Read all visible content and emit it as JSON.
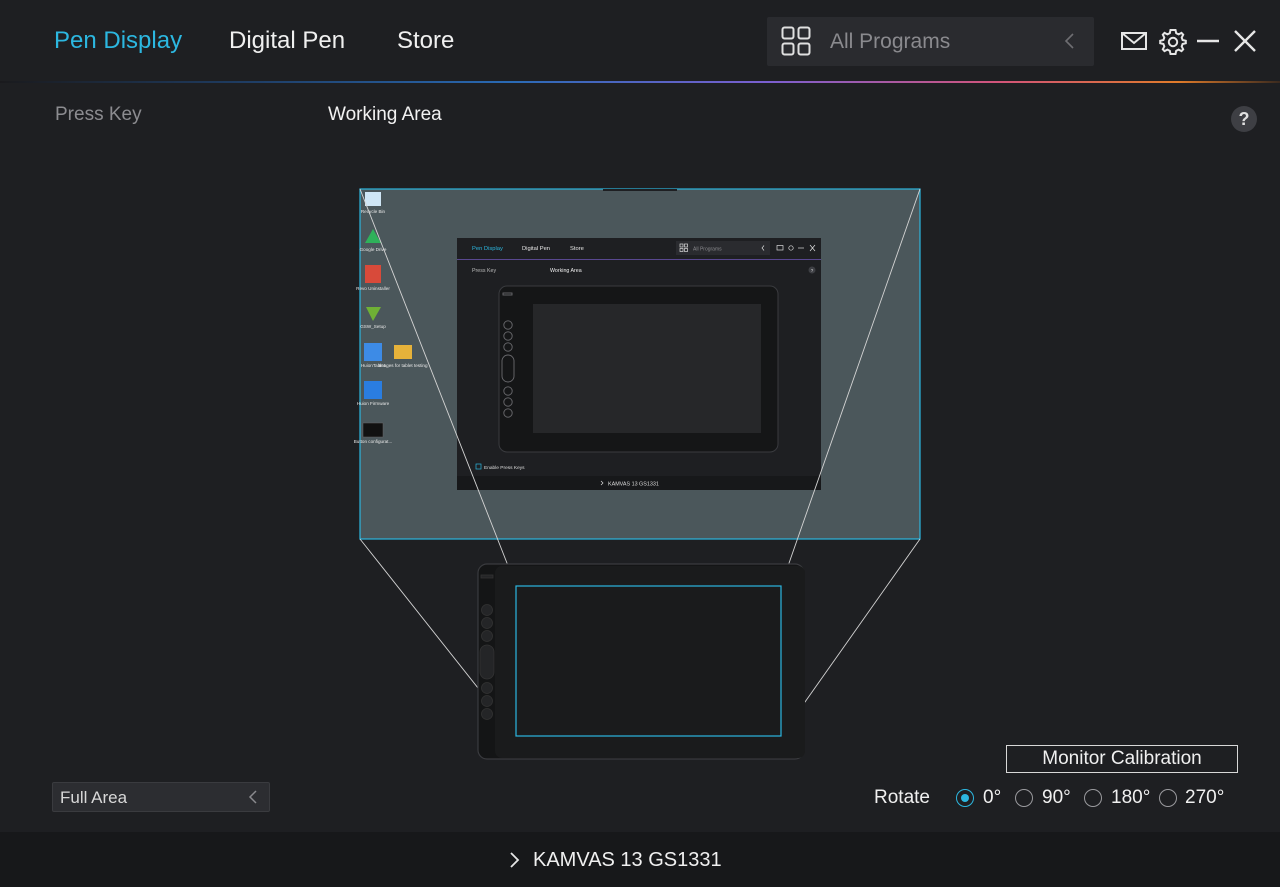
{
  "header": {
    "tabs": [
      {
        "label": "Pen Display",
        "active": true
      },
      {
        "label": "Digital Pen",
        "active": false
      },
      {
        "label": "Store",
        "active": false
      }
    ],
    "program_selector": {
      "label": "All Programs"
    },
    "icons": [
      "mail-icon",
      "gear-icon",
      "minimize-icon",
      "close-icon"
    ]
  },
  "subtabs": [
    {
      "label": "Press Key",
      "active": false
    },
    {
      "label": "Working Area",
      "active": true
    }
  ],
  "help_label": "?",
  "preview": {
    "desktop_icons": [
      "Recycle Bin",
      "Google Drive",
      "Revo Uninstaller",
      "GSW_Setup",
      "HuionTablet",
      "Images for tablet testing",
      "Huion Firmware",
      "Button configurat..."
    ],
    "mini_app": {
      "tabs": [
        "Pen Display",
        "Digital Pen",
        "Store"
      ],
      "program_label": "All Programs",
      "subtabs": [
        "Press Key",
        "Working Area"
      ],
      "enable_press_keys": "Enable Press Keys",
      "device": "KAMVAS 13 GS1331"
    }
  },
  "area_select": {
    "value": "Full Area"
  },
  "calibration_label": "Monitor Calibration",
  "rotate": {
    "label": "Rotate",
    "options": [
      {
        "label": "0°",
        "checked": true
      },
      {
        "label": "90°",
        "checked": false
      },
      {
        "label": "180°",
        "checked": false
      },
      {
        "label": "270°",
        "checked": false
      }
    ]
  },
  "footer": {
    "device_name": "KAMVAS 13 GS1331"
  },
  "colors": {
    "accent": "#2cb7e0",
    "background": "#1e1f22",
    "preview_bg": "#4b575b"
  }
}
